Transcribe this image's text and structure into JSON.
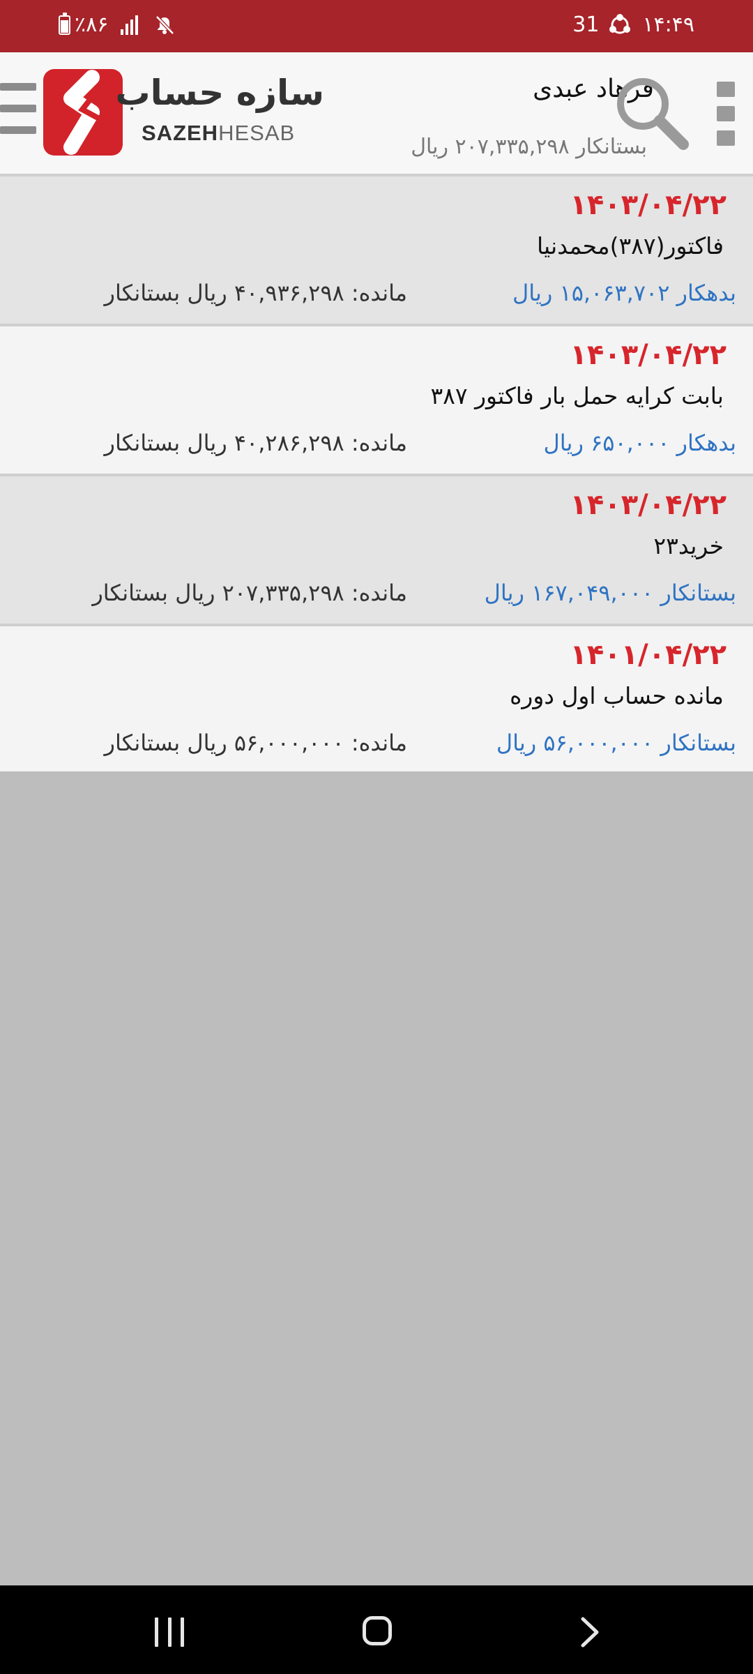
{
  "status_bar": {
    "battery": "٪۸۶",
    "date_badge": "31",
    "time": "۱۴:۴۹"
  },
  "header": {
    "logo_fa": "سازه حساب",
    "logo_en_bold": "SAZEH",
    "logo_en_light": "HESAB",
    "customer_name": "فرهاد عبدی",
    "customer_balance": "بستانکار ۲۰۷,۳۳۵,۲۹۸ ریال"
  },
  "transactions": [
    {
      "date": "۱۴۰۳/۰۴/۲۲",
      "description": "فاکتور(۳۸۷)محمدنیا",
      "amount": "بدهکار ۱۵,۰۶۳,۷۰۲ ریال",
      "remain": "مانده: ۴۰,۹۳۶,۲۹۸ ریال بستانکار"
    },
    {
      "date": "۱۴۰۳/۰۴/۲۲",
      "description": "بابت کرایه حمل بار فاکتور ۳۸۷",
      "amount": "بدهکار ۶۵۰,۰۰۰ ریال",
      "remain": "مانده: ۴۰,۲۸۶,۲۹۸ ریال بستانکار"
    },
    {
      "date": "۱۴۰۳/۰۴/۲۲",
      "description": "خرید۲۳",
      "amount": "بستانکار ۱۶۷,۰۴۹,۰۰۰ ریال",
      "remain": "مانده: ۲۰۷,۳۳۵,۲۹۸ ریال بستانکار"
    },
    {
      "date": "۱۴۰۱/۰۴/۲۲",
      "description": "مانده حساب اول دوره",
      "amount": "بستانکار ۵۶,۰۰۰,۰۰۰ ریال",
      "remain": "مانده: ۵۶,۰۰۰,۰۰۰ ریال بستانکار"
    }
  ],
  "colors": {
    "status_bar": "#a6242a",
    "date": "#d6262c",
    "amount": "#2f73c2"
  },
  "icons": [
    "battery-icon",
    "signal-icon",
    "mute-icon",
    "sync-icon",
    "menu-icon",
    "logo-icon",
    "search-icon",
    "more-icon",
    "recent-apps-icon",
    "home-icon",
    "back-icon"
  ]
}
